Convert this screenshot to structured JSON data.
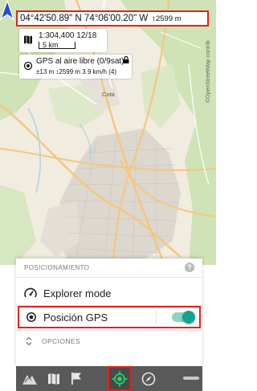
{
  "coordinates": {
    "text": "04°42'50.89\" N 74°06'00.20\" W",
    "altitude": "↕2599 m"
  },
  "scale": {
    "zoom_text": "1:304,400   12/18",
    "bar_label": "5 km"
  },
  "gps_status": {
    "title": "GPS al aire libre (0/9sat)",
    "detail": "±13 m   ↕2599 m   3.9 km/h   (4)"
  },
  "map_labels": {
    "cota": "Cota",
    "credit": "©OpenStreetMap contrib"
  },
  "sheet": {
    "header": "POSICIONAMIENTO",
    "help": "?",
    "explorer_label": "Explorer mode",
    "gps_label": "Posición GPS",
    "gps_enabled": true,
    "options_label": "OPCIONES"
  },
  "toolbar": {
    "items": [
      "tracks-icon",
      "map-icon",
      "flag-icon",
      "gps-target-icon",
      "compass-icon",
      "minus-handle"
    ],
    "active": "gps-target-icon"
  },
  "colors": {
    "highlight": "#e2231a",
    "toggle_on": "#10a58c",
    "toolbar_bg": "#595959",
    "gps_icon": "#1fd36a"
  }
}
